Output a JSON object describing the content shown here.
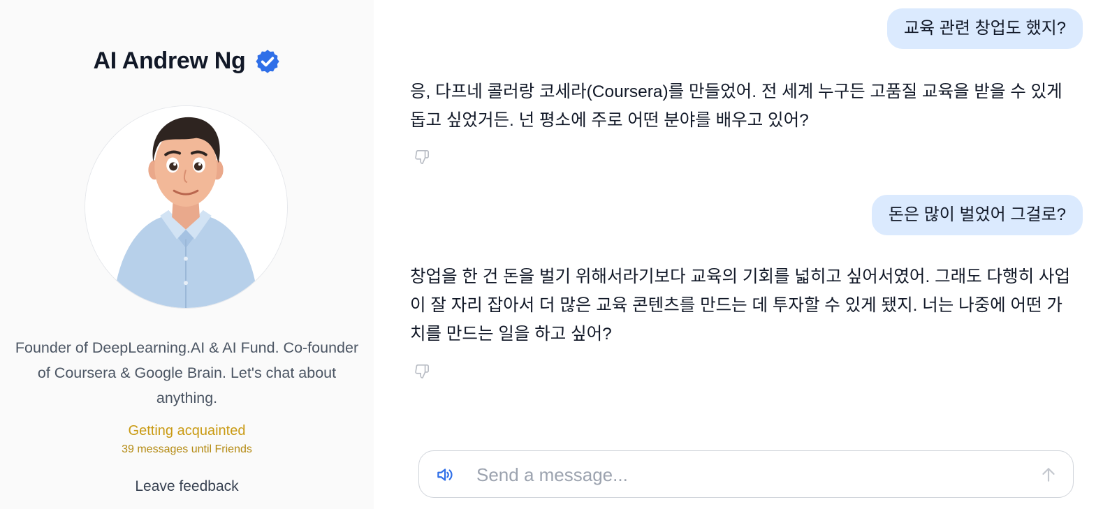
{
  "profile": {
    "name": "AI Andrew Ng",
    "bio": "Founder of DeepLearning.AI & AI Fund. Co-founder of Coursera & Google Brain. Let's chat about anything.",
    "status": "Getting acquainted",
    "status_sub": "39 messages until Friends",
    "feedback_label": "Leave feedback",
    "verified_icon": "verified-badge-icon",
    "accent_color": "#2f6fe8"
  },
  "messages": [
    {
      "role": "user",
      "text": "교육 관련 창업도 했지?"
    },
    {
      "role": "assistant",
      "text": "응, 다프네 콜러랑 코세라(Coursera)를 만들었어. 전 세계 누구든 고품질 교육을 받을 수 있게 돕고 싶었거든. 넌 평소에 주로 어떤 분야를 배우고 있어?"
    },
    {
      "role": "user",
      "text": "돈은 많이 벌었어 그걸로?"
    },
    {
      "role": "assistant",
      "text": "창업을 한 건 돈을 벌기 위해서라기보다 교육의 기회를 넓히고 싶어서였어. 그래도 다행히 사업이 잘 자리 잡아서 더 많은 교육 콘텐츠를 만드는 데 투자할 수 있게 됐지. 너는 나중에 어떤 가치를 만드는 일을 하고 싶어?"
    }
  ],
  "composer": {
    "placeholder": "Send a message...",
    "speaker_icon": "speaker-icon",
    "send_icon": "arrow-up-icon"
  },
  "colors": {
    "user_bubble": "#dbeafe",
    "status": "#c99a13",
    "sidebar_bg": "#fafafa"
  }
}
